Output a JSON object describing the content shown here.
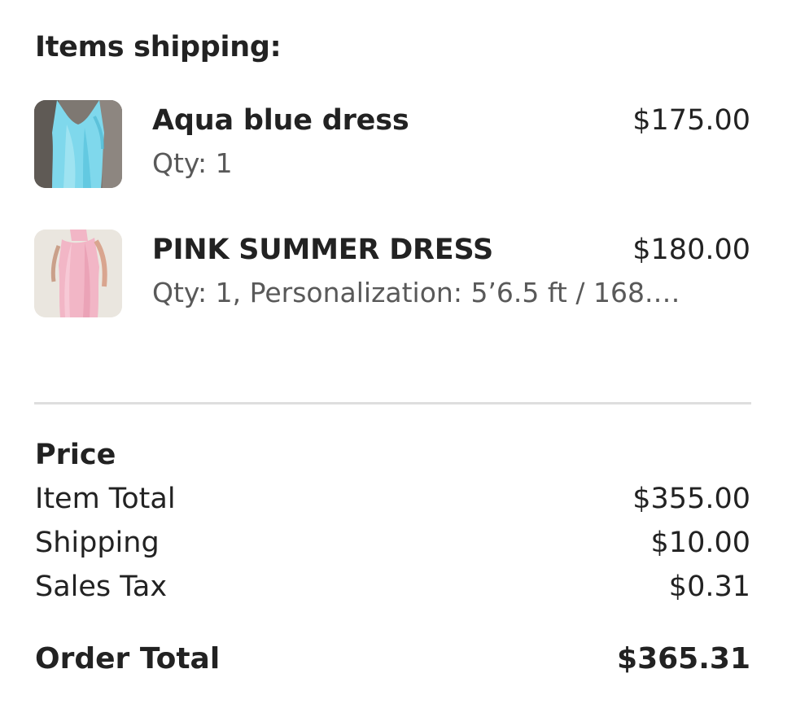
{
  "shipping": {
    "title": "Items shipping:",
    "items": [
      {
        "name": "Aqua blue dress",
        "meta": "Qty: 1",
        "price": "$175.00",
        "thumbnail": "aqua-dress-photo"
      },
      {
        "name": "PINK SUMMER DRESS",
        "meta": "Qty: 1, Personalization: 5’6.5 ft / 168.…",
        "price": "$180.00",
        "thumbnail": "pink-dress-photo"
      }
    ]
  },
  "price": {
    "heading": "Price",
    "item_total_label": "Item Total",
    "item_total_value": "$355.00",
    "shipping_label": "Shipping",
    "shipping_value": "$10.00",
    "tax_label": "Sales Tax",
    "tax_value": "$0.31",
    "order_total_label": "Order Total",
    "order_total_value": "$365.31"
  },
  "colors": {
    "text": "#222222",
    "muted_text": "#595959",
    "divider": "#dedede",
    "aqua": "#7fd8ec",
    "pink": "#f2b6c6"
  }
}
